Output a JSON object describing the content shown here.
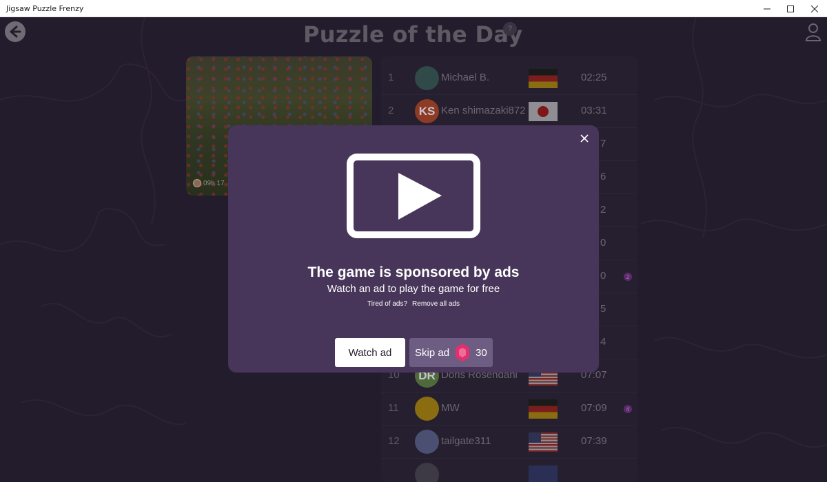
{
  "window": {
    "title": "Jigsaw Puzzle Frenzy"
  },
  "header": {
    "title": "Puzzle of the Day",
    "help_label": "?"
  },
  "puzzle": {
    "timer": "09h 17"
  },
  "leaderboard": {
    "rows": [
      {
        "rank": "1",
        "avatar_text": "",
        "avatar_color": "#2f4a49",
        "name": "Michael B.",
        "flag": "de",
        "time": "02:25",
        "badge": ""
      },
      {
        "rank": "2",
        "avatar_text": "KS",
        "avatar_color": "#8d3b24",
        "name": "Ken shimazaki872",
        "flag": "jp",
        "time": "03:31",
        "badge": ""
      },
      {
        "rank": "",
        "avatar_text": "",
        "avatar_color": "",
        "name": "",
        "flag": "",
        "time": "7",
        "badge": ""
      },
      {
        "rank": "",
        "avatar_text": "",
        "avatar_color": "",
        "name": "",
        "flag": "",
        "time": "6",
        "badge": ""
      },
      {
        "rank": "",
        "avatar_text": "",
        "avatar_color": "",
        "name": "",
        "flag": "",
        "time": "2",
        "badge": ""
      },
      {
        "rank": "",
        "avatar_text": "",
        "avatar_color": "",
        "name": "",
        "flag": "",
        "time": "0",
        "badge": ""
      },
      {
        "rank": "",
        "avatar_text": "",
        "avatar_color": "",
        "name": "",
        "flag": "",
        "time": "0",
        "badge": "2"
      },
      {
        "rank": "",
        "avatar_text": "",
        "avatar_color": "",
        "name": "",
        "flag": "",
        "time": "5",
        "badge": ""
      },
      {
        "rank": "",
        "avatar_text": "",
        "avatar_color": "",
        "name": "",
        "flag": "",
        "time": "4",
        "badge": ""
      },
      {
        "rank": "10",
        "avatar_text": "DR",
        "avatar_color": "#4f6a3a",
        "name": "Doris Rosendahl",
        "flag": "us",
        "time": "07:07",
        "badge": ""
      },
      {
        "rank": "11",
        "avatar_text": "",
        "avatar_color": "#8a6d10",
        "name": "MW",
        "flag": "de",
        "time": "07:09",
        "badge": "4"
      },
      {
        "rank": "12",
        "avatar_text": "",
        "avatar_color": "#4b4f72",
        "name": "tailgate311",
        "flag": "us",
        "time": "07:39",
        "badge": ""
      },
      {
        "rank": "",
        "avatar_text": "",
        "avatar_color": "#3d3a45",
        "name": "",
        "flag": "gb",
        "time": "",
        "badge": ""
      }
    ]
  },
  "modal": {
    "heading": "The game is sponsored by ads",
    "subheading": "Watch an ad to play the game for free",
    "tired_text": "Tired of ads?",
    "remove_link": "Remove all ads",
    "watch_button": "Watch ad",
    "skip_button": "Skip ad",
    "skip_cost": "30",
    "gem_icon": "pink-gem-icon",
    "accent_color": "#e0306e"
  }
}
